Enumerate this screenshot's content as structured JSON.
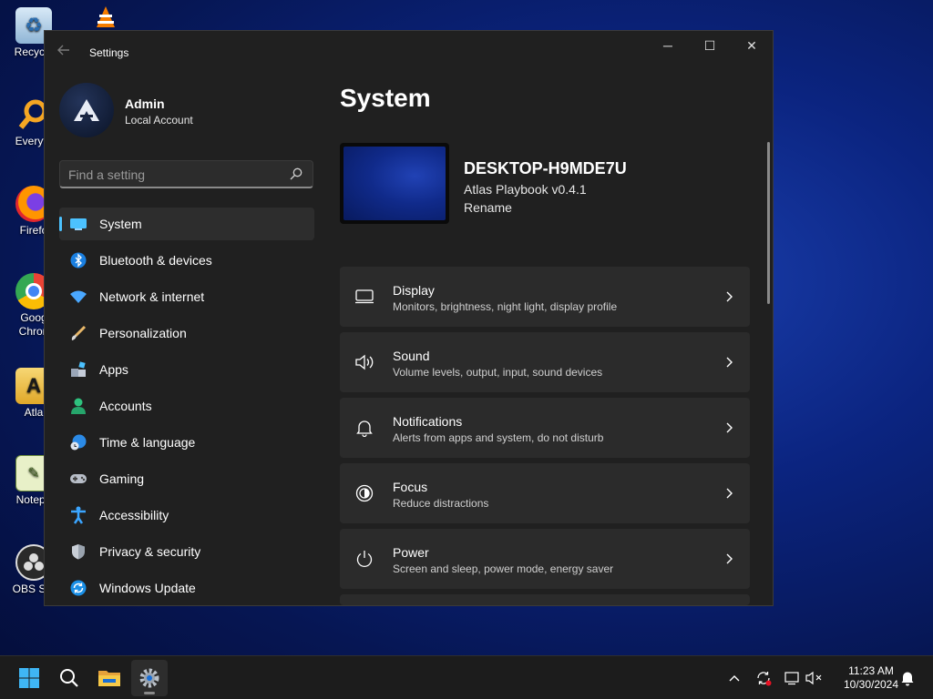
{
  "desktop": {
    "icons": [
      {
        "label": "Recycle",
        "icon": "recycle-bin-icon"
      },
      {
        "label": "Everyth",
        "icon": "everything-search-icon"
      },
      {
        "label": "Firefo",
        "icon": "firefox-icon"
      },
      {
        "label": "Goog Chron",
        "icon": "chrome-icon"
      },
      {
        "label": "Atla",
        "icon": "atlas-folder-icon"
      },
      {
        "label": "Notepa",
        "icon": "notepad-icon"
      },
      {
        "label": "OBS Stu",
        "icon": "obs-icon"
      }
    ],
    "google_line1": "Goog",
    "google_line2": "Chron"
  },
  "window": {
    "app_title": "Settings",
    "minimize": "─",
    "maximize": "☐",
    "close": "✕"
  },
  "profile": {
    "name": "Admin",
    "account_type": "Local Account"
  },
  "search": {
    "placeholder": "Find a setting",
    "value": ""
  },
  "sidebar": {
    "items": [
      {
        "label": "System",
        "icon": "system-icon",
        "selected": true
      },
      {
        "label": "Bluetooth & devices",
        "icon": "bluetooth-icon"
      },
      {
        "label": "Network & internet",
        "icon": "network-icon"
      },
      {
        "label": "Personalization",
        "icon": "brush-icon"
      },
      {
        "label": "Apps",
        "icon": "apps-icon"
      },
      {
        "label": "Accounts",
        "icon": "accounts-icon"
      },
      {
        "label": "Time & language",
        "icon": "time-language-icon"
      },
      {
        "label": "Gaming",
        "icon": "gaming-icon"
      },
      {
        "label": "Accessibility",
        "icon": "accessibility-icon"
      },
      {
        "label": "Privacy & security",
        "icon": "shield-icon"
      },
      {
        "label": "Windows Update",
        "icon": "windows-update-icon"
      }
    ]
  },
  "main": {
    "title": "System",
    "device": {
      "name": "DESKTOP-H9MDE7U",
      "model": "Atlas Playbook v0.4.1",
      "rename": "Rename"
    },
    "cards": [
      {
        "title": "Display",
        "desc": "Monitors, brightness, night light, display profile",
        "icon": "display-icon"
      },
      {
        "title": "Sound",
        "desc": "Volume levels, output, input, sound devices",
        "icon": "speaker-icon"
      },
      {
        "title": "Notifications",
        "desc": "Alerts from apps and system, do not disturb",
        "icon": "bell-icon"
      },
      {
        "title": "Focus",
        "desc": "Reduce distractions",
        "icon": "focus-icon"
      },
      {
        "title": "Power",
        "desc": "Screen and sleep, power mode, energy saver",
        "icon": "power-icon"
      }
    ]
  },
  "taskbar": {
    "time": "11:23 AM",
    "date": "10/30/2024",
    "apps": [
      "start-icon",
      "search-icon",
      "file-explorer-icon",
      "settings-icon"
    ],
    "tray": [
      "chevron-up-icon",
      "sync-icon",
      "network-status-icon",
      "speaker-muted-icon",
      "notification-bell-icon"
    ]
  },
  "colors": {
    "accent": "#4cc2ff",
    "window_bg": "#202020",
    "card_bg": "#2b2b2b",
    "taskbar_bg": "#1c1c1c"
  }
}
